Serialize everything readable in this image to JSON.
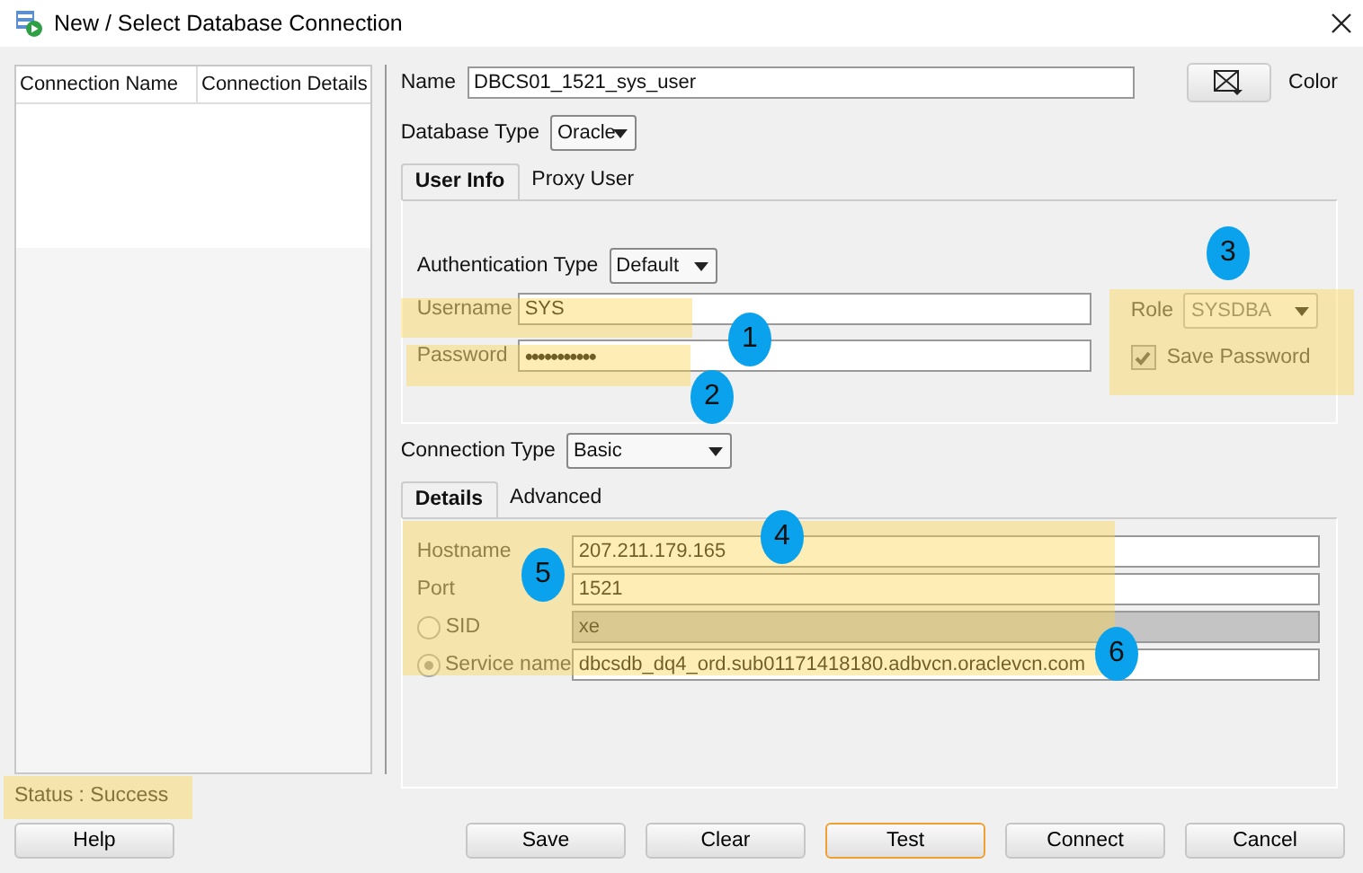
{
  "window": {
    "title": "New / Select Database Connection"
  },
  "connection_list": {
    "columns": [
      "Connection Name",
      "Connection Details"
    ]
  },
  "name": {
    "label": "Name",
    "value": "DBCS01_1521_sys_user"
  },
  "color_button": {
    "label": "Color"
  },
  "database_type": {
    "label": "Database Type",
    "value": "Oracle"
  },
  "tabs": [
    {
      "label": "User Info",
      "selected": true
    },
    {
      "label": "Proxy User",
      "selected": false
    }
  ],
  "authentication_type": {
    "label": "Authentication Type",
    "value": "Default"
  },
  "username": {
    "label": "Username",
    "value": "SYS"
  },
  "password": {
    "label": "Password",
    "value": "•••••••••••"
  },
  "role": {
    "label": "Role",
    "value": "SYSDBA",
    "disabled": true
  },
  "save_password": {
    "label": "Save Password",
    "checked": true,
    "disabled": true
  },
  "connection_type": {
    "label": "Connection Type",
    "value": "Basic"
  },
  "detail_tabs": [
    {
      "label": "Details",
      "selected": true
    },
    {
      "label": "Advanced",
      "selected": false
    }
  ],
  "hostname": {
    "label": "Hostname",
    "value": "207.211.179.165"
  },
  "port": {
    "label": "Port",
    "value": "1521"
  },
  "target": [
    {
      "label": "SID",
      "value": "xe",
      "selected": false
    },
    {
      "label": "Service name",
      "value": "dbcsdb_dq4_ord.sub01171418180.adbvcn.oraclevcn.com",
      "selected": true
    }
  ],
  "status": "Status : Success",
  "buttons": [
    {
      "label": "Help",
      "focused": false
    },
    {
      "label": "Save",
      "focused": false
    },
    {
      "label": "Clear",
      "focused": false
    },
    {
      "label": "Test",
      "focused": true
    },
    {
      "label": "Connect",
      "focused": false
    },
    {
      "label": "Cancel",
      "focused": false
    }
  ],
  "callouts": [
    "1",
    "2",
    "3",
    "4",
    "5",
    "6"
  ]
}
